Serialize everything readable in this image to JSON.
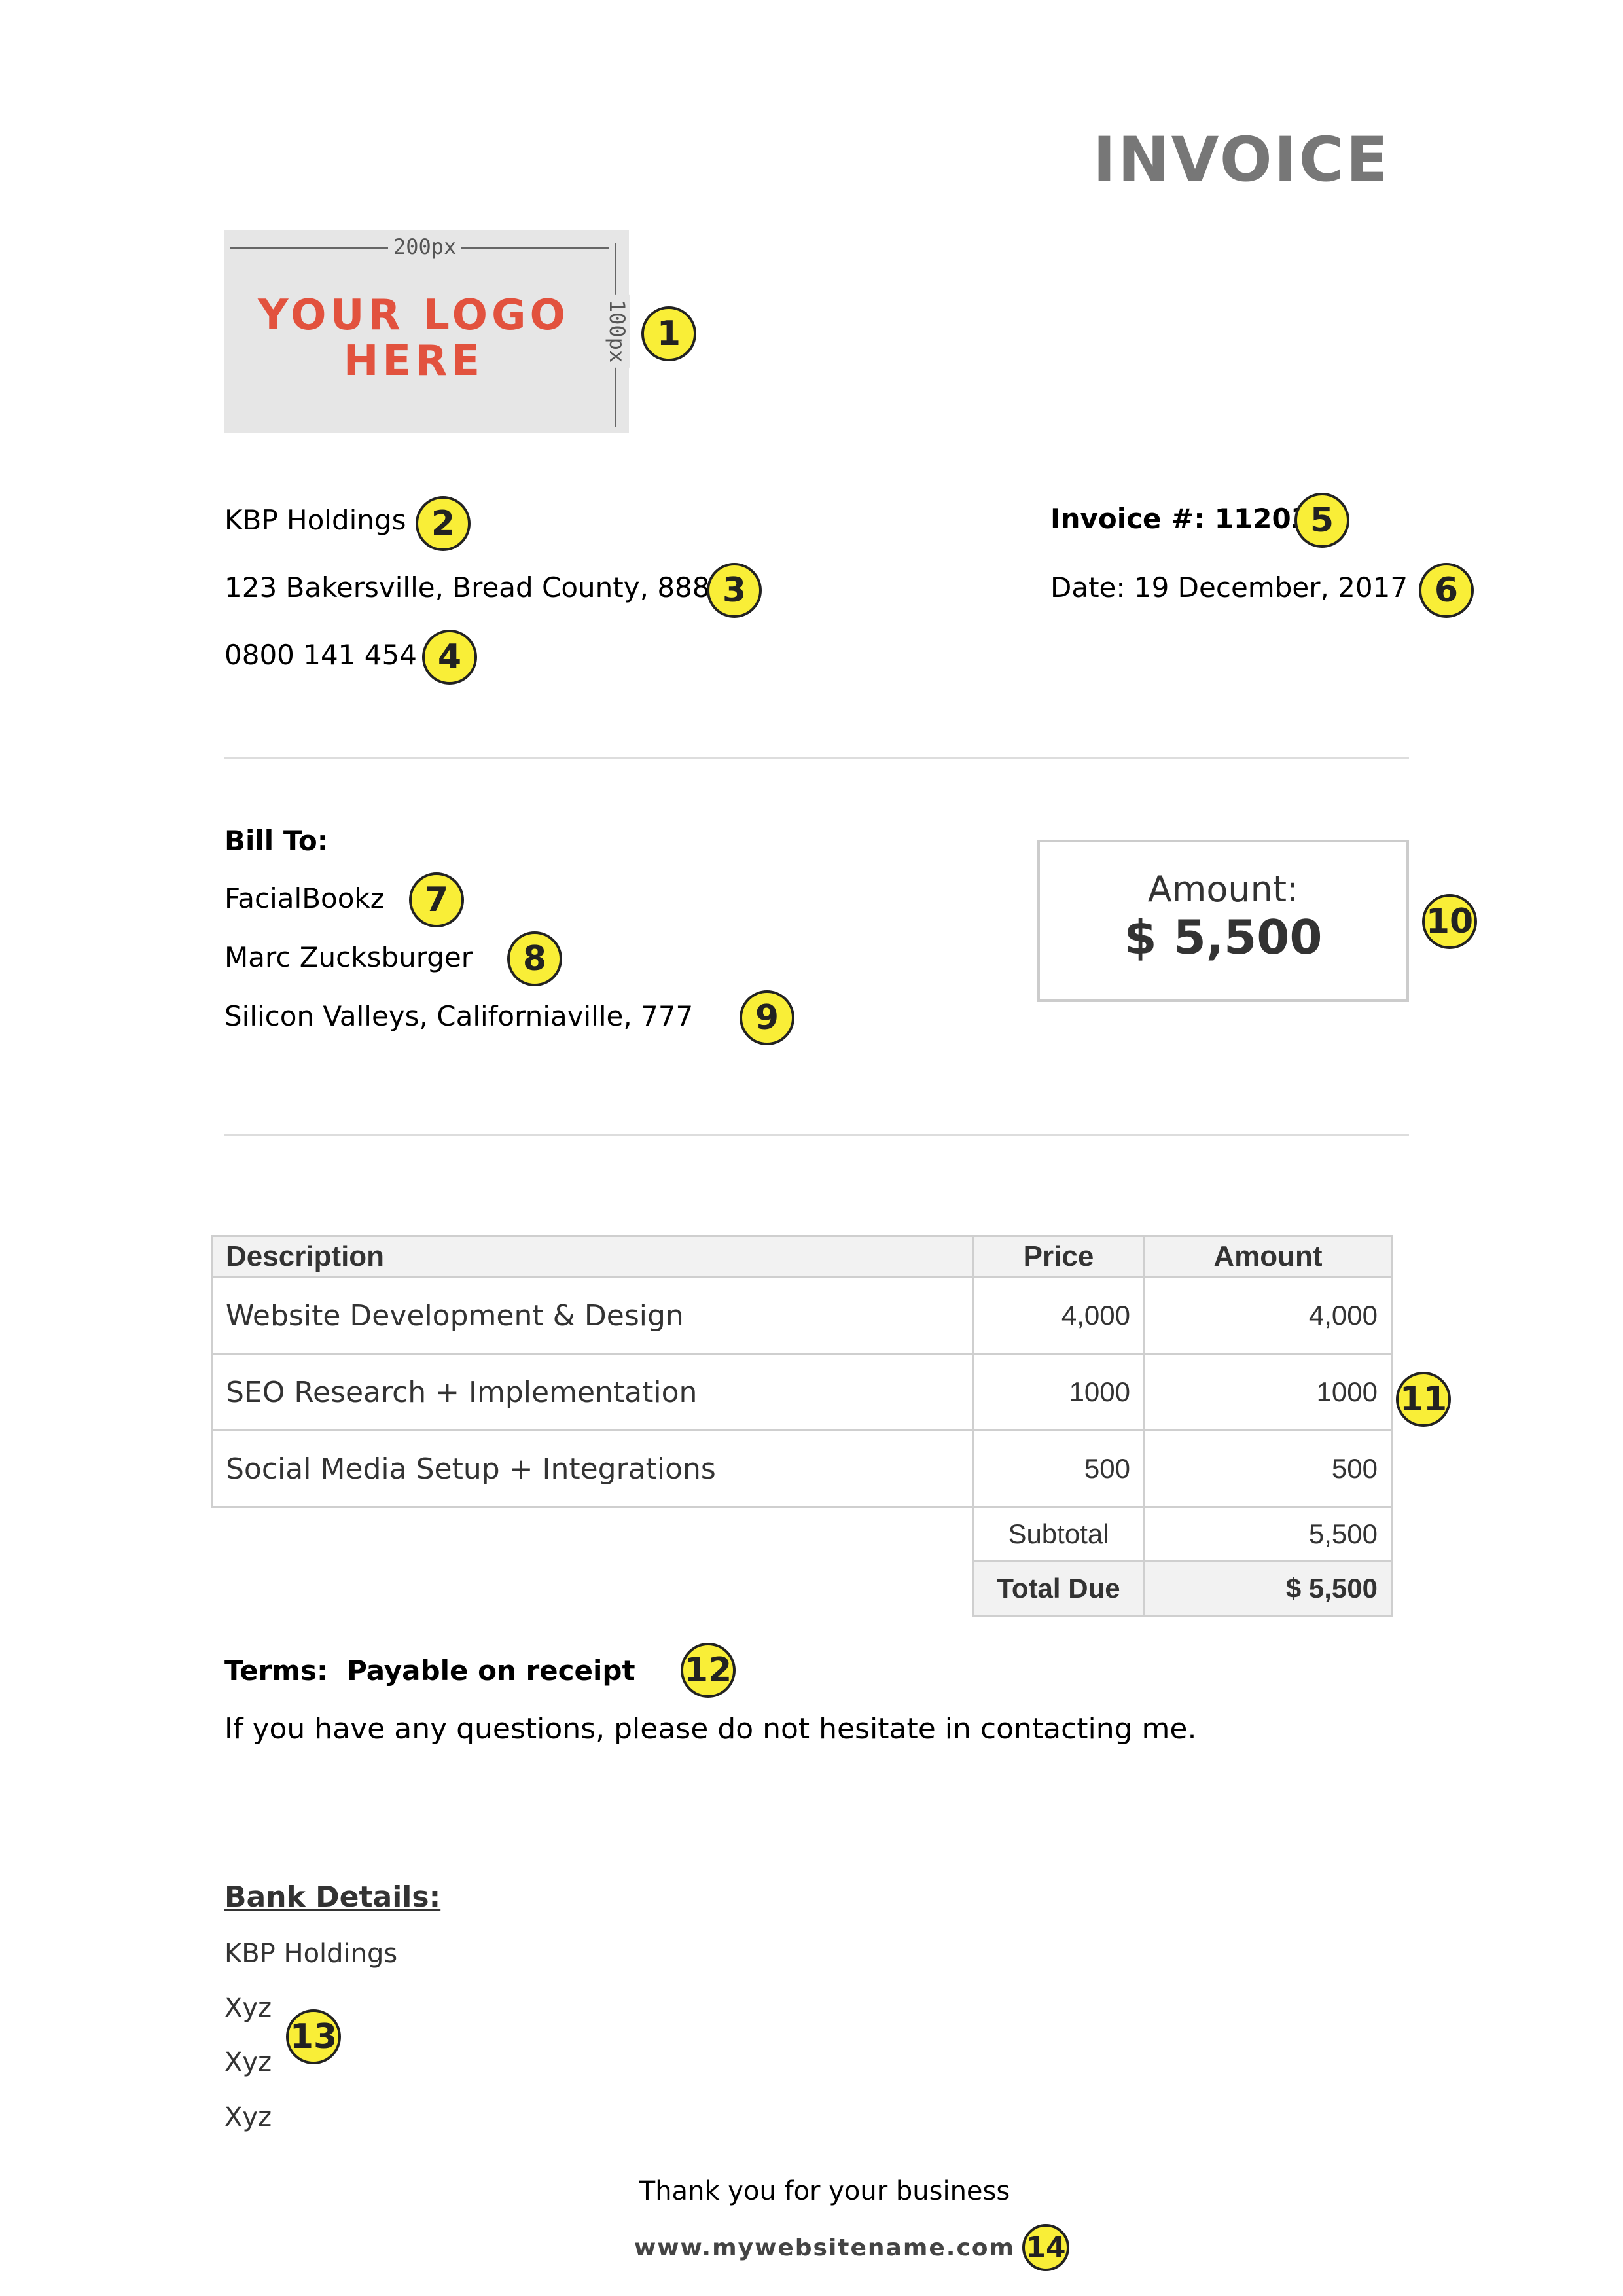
{
  "header": {
    "title": "INVOICE"
  },
  "logo": {
    "text_line1": "YOUR LOGO",
    "text_line2": "HERE",
    "width_label": "200px",
    "height_label": "100px"
  },
  "sender": {
    "name": "KBP Holdings",
    "address": "123 Bakersville, Bread County, 888",
    "phone": "0800 141 454"
  },
  "invoice_meta": {
    "number_label": "Invoice #:",
    "number": "11203",
    "date": "Date: 19 December, 2017"
  },
  "bill_to": {
    "heading": "Bill To:",
    "company": "FacialBookz",
    "contact": "Marc Zucksburger",
    "address": "Silicon Valleys, Californiaville, 777"
  },
  "amount_box": {
    "label": "Amount:",
    "value": "$ 5,500"
  },
  "table": {
    "headers": [
      "Description",
      "Price",
      "Amount"
    ],
    "rows": [
      {
        "description": "Website Development & Design",
        "price": "4,000",
        "amount": "4,000"
      },
      {
        "description": "SEO Research + Implementation",
        "price": "1000",
        "amount": "1000"
      },
      {
        "description": "Social Media Setup + Integrations",
        "price": "500",
        "amount": "500"
      }
    ],
    "subtotal_label": "Subtotal",
    "subtotal": "5,500",
    "total_label": "Total Due",
    "total": "$ 5,500"
  },
  "terms": {
    "label": "Terms:",
    "value": "Payable on receipt",
    "note": "If you have any questions, please do not hesitate in contacting me."
  },
  "bank": {
    "heading": "Bank Details:",
    "lines": [
      "KBP Holdings",
      "Xyz",
      "Xyz",
      "Xyz"
    ]
  },
  "footer": {
    "thanks": "Thank you for your business",
    "website": "www.mywebsitename.com"
  },
  "badges": [
    "1",
    "2",
    "3",
    "4",
    "5",
    "6",
    "7",
    "8",
    "9",
    "10",
    "11",
    "12",
    "13",
    "14"
  ],
  "colors": {
    "badge": "#f9ee37",
    "logo_text": "#e2523e",
    "title": "#777777"
  }
}
